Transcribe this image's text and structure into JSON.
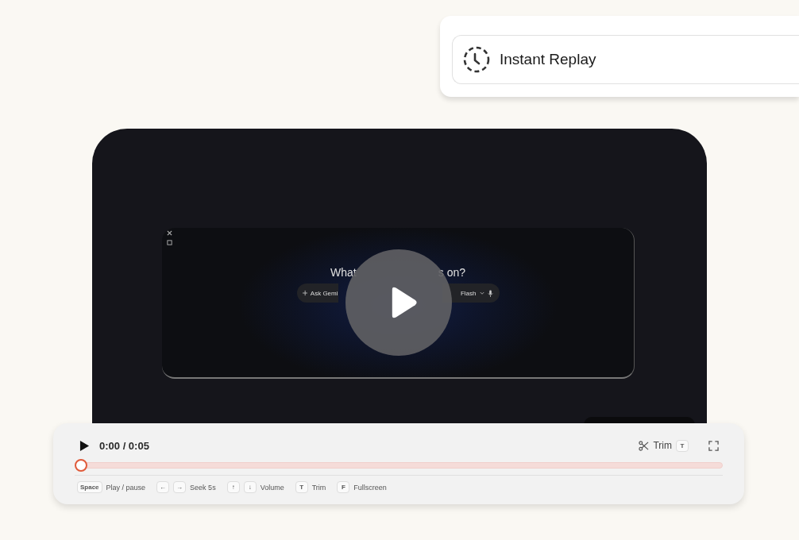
{
  "header": {
    "title": "Instant Replay"
  },
  "video": {
    "screen": {
      "heading_parts": [
        "What",
        "s on?"
      ],
      "prompt": {
        "placeholder": "Ask Gemi"
      },
      "model": "Flash"
    }
  },
  "player": {
    "playing": false,
    "time": "0:00 / 0:05",
    "trim": {
      "label": "Trim",
      "key": "T"
    },
    "progress": {
      "level": 0
    },
    "shortcuts": [
      {
        "keys": [
          "Space"
        ],
        "label": "Play / pause"
      },
      {
        "keys": [
          "←",
          "→"
        ],
        "label": "Seek 5s"
      },
      {
        "keys": [
          "↑",
          "↓"
        ],
        "label": "Volume"
      },
      {
        "keys": [
          "T"
        ],
        "label": "Trim"
      },
      {
        "keys": [
          "F"
        ],
        "label": "Fullscreen"
      }
    ]
  }
}
